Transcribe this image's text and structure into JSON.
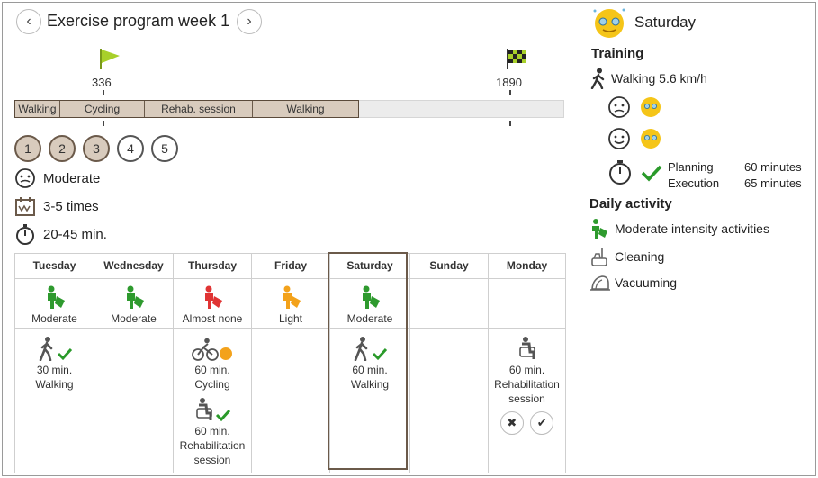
{
  "header": {
    "title": "Exercise program week 1",
    "prev_icon": "chevron-left-icon",
    "next_icon": "chevron-right-icon"
  },
  "progress": {
    "start_flag_value": "336",
    "goal_flag_value": "1890",
    "segments": [
      "Walking",
      "Cycling",
      "Rehab. session",
      "Walking"
    ]
  },
  "steps": [
    "1",
    "2",
    "3",
    "4",
    "5"
  ],
  "steps_completed": 3,
  "program": {
    "intensity": "Moderate",
    "frequency": "3-5 times",
    "duration": "20-45 min."
  },
  "days": [
    {
      "name": "Tuesday",
      "level": "Moderate"
    },
    {
      "name": "Wednesday",
      "level": "Moderate"
    },
    {
      "name": "Thursday",
      "level": "Almost none"
    },
    {
      "name": "Friday",
      "level": "Light"
    },
    {
      "name": "Saturday",
      "level": "Moderate"
    },
    {
      "name": "Sunday",
      "level": ""
    },
    {
      "name": "Monday",
      "level": ""
    }
  ],
  "activities": {
    "tuesday": {
      "duration": "30 min.",
      "name": "Walking"
    },
    "thursday_1": {
      "duration": "60 min.",
      "name": "Cycling"
    },
    "thursday_2": {
      "duration": "60 min.",
      "name": "Rehabilitation session"
    },
    "saturday": {
      "duration": "60 min.",
      "name": "Walking"
    },
    "monday": {
      "duration": "60 min.",
      "name": "Rehabilitation session"
    }
  },
  "detail": {
    "day": "Saturday",
    "training_heading": "Training",
    "training_activity": "Walking 5.6 km/h",
    "planning_label": "Planning",
    "planning_value": "60 minutes",
    "execution_label": "Execution",
    "execution_value": "65 minutes",
    "daily_heading": "Daily activity",
    "daily_items": [
      "Moderate intensity activities",
      "Cleaning",
      "Vacuuming"
    ]
  },
  "colors": {
    "moderate": "#2e9a2e",
    "almost_none": "#e03434",
    "light": "#f3a21b",
    "done": "#d8cbbd",
    "check": "#2a9a2a",
    "face": "#f5c518"
  }
}
